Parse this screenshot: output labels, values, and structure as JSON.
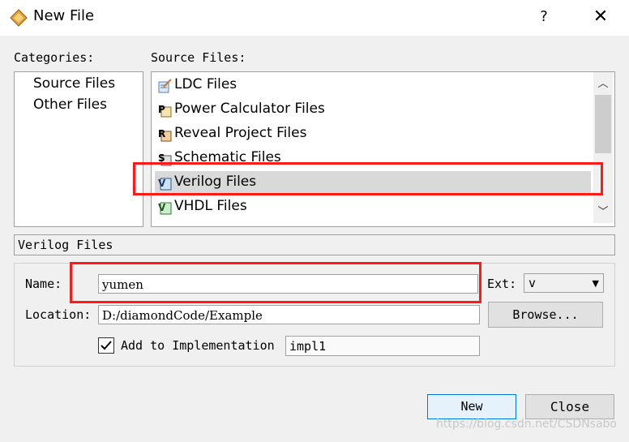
{
  "window": {
    "title": "New File",
    "help_glyph": "?",
    "close_glyph": "✕"
  },
  "categories": {
    "label": "Categories:",
    "items": [
      "Source Files",
      "Other Files"
    ]
  },
  "source_files": {
    "label": "Source Files:",
    "items": [
      {
        "label": "LDC Files",
        "icon": "ldc-file-icon"
      },
      {
        "label": "Power Calculator Files",
        "icon": "power-calculator-file-icon"
      },
      {
        "label": "Reveal Project Files",
        "icon": "reveal-project-file-icon"
      },
      {
        "label": "Schematic Files",
        "icon": "schematic-file-icon"
      },
      {
        "label": "Verilog Files",
        "icon": "verilog-file-icon",
        "selected": true
      },
      {
        "label": "VHDL Files",
        "icon": "vhdl-file-icon"
      }
    ]
  },
  "description": "Verilog Files",
  "form": {
    "name_label": "Name:",
    "name_value": "yumen",
    "ext_label": "Ext:",
    "ext_value": "v",
    "location_label": "Location:",
    "location_value": "D:/diamondCode/Example",
    "browse_label": "Browse...",
    "add_impl_label": "Add to Implementation",
    "add_impl_checked": true,
    "impl_value": "impl1"
  },
  "buttons": {
    "new_label": "New",
    "close_label": "Close"
  },
  "watermark": "https://blog.csdn.net/CSDNsabo",
  "colors": {
    "highlight": "#ff1a1a",
    "selection": "#d9d9d9"
  }
}
